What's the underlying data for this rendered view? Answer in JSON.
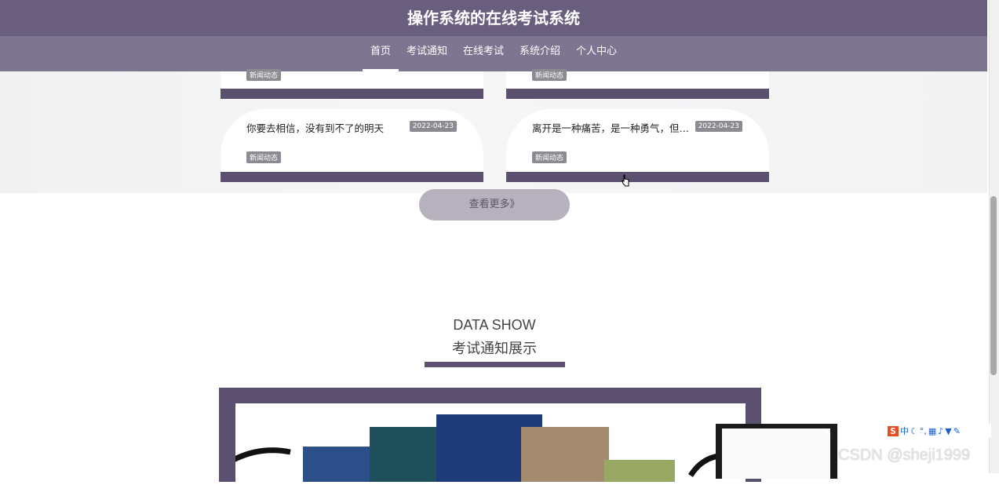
{
  "header": {
    "site_title": "操作系统的在线考试系统",
    "nav": [
      {
        "label": "首页",
        "active": true
      },
      {
        "label": "考试通知",
        "active": false
      },
      {
        "label": "在线考试",
        "active": false
      },
      {
        "label": "系统介绍",
        "active": false
      },
      {
        "label": "个人中心",
        "active": false
      }
    ]
  },
  "news": {
    "partial_cards": [
      {
        "tag": "新闻动态"
      },
      {
        "tag": "新闻动态"
      }
    ],
    "cards": [
      {
        "title": "你要去相信，没有到不了的明天",
        "date": "2022-04-23",
        "tag": "新闻动态"
      },
      {
        "title": "离开是一种痛苦，是一种勇气，但同样也是一个考验",
        "date": "2022-04-23",
        "tag": "新闻动态"
      }
    ],
    "more_label": "查看更多》"
  },
  "data_show": {
    "title_en": "DATA SHOW",
    "title_cn": "考试通知展示"
  },
  "overlay": {
    "watermark": "CSDN @sheji1999",
    "ime_cn": "中",
    "close_icon": "×"
  },
  "colors": {
    "header": "#6a5e7f",
    "accent": "#5c5070",
    "button": "#b6b1bd"
  }
}
